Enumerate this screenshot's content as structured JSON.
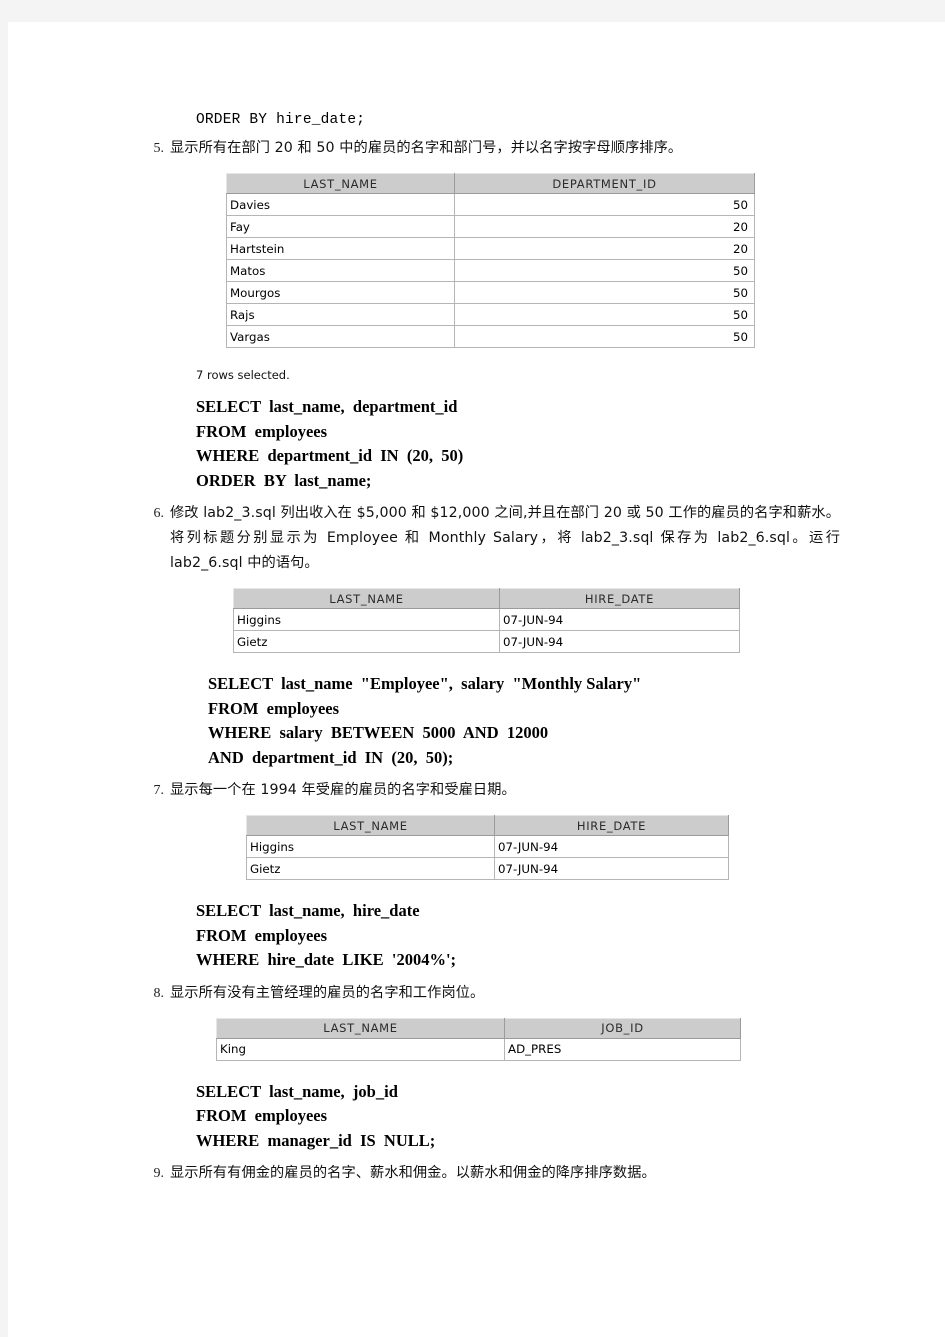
{
  "document": {
    "top_code_line": "ORDER BY hire_date;",
    "rows_selected_note": "7 rows selected."
  },
  "items": [
    {
      "number": "5.",
      "text": "显示所有在部门 20 和 50 中的雇员的名字和部门号，并以名字按字母顺序排序。"
    },
    {
      "number": "6.",
      "text": "修改 lab2_3.sql 列出收入在 $5,000 和 $12,000 之间,并且在部门 20 或 50 工作的雇员的名字和薪水。将列标题分别显示为 Employee 和 Monthly Salary，将 lab2_3.sql 保存为 lab2_6.sql。运行 lab2_6.sql 中的语句。"
    },
    {
      "number": "7.",
      "text": "显示每一个在 1994 年受雇的雇员的名字和受雇日期。"
    },
    {
      "number": "8.",
      "text": "显示所有没有主管经理的雇员的名字和工作岗位。"
    },
    {
      "number": "9.",
      "text": "显示所有有佣金的雇员的名字、薪水和佣金。以薪水和佣金的降序排序数据。"
    }
  ],
  "tables": {
    "t5": {
      "headers": [
        "LAST_NAME",
        "DEPARTMENT_ID"
      ],
      "rows": [
        [
          "Davies",
          "50"
        ],
        [
          "Fay",
          "20"
        ],
        [
          "Hartstein",
          "20"
        ],
        [
          "Matos",
          "50"
        ],
        [
          "Mourgos",
          "50"
        ],
        [
          "Rajs",
          "50"
        ],
        [
          "Vargas",
          "50"
        ]
      ]
    },
    "t6": {
      "headers": [
        "LAST_NAME",
        "HIRE_DATE"
      ],
      "rows": [
        [
          "Higgins",
          "07-JUN-94"
        ],
        [
          "Gietz",
          "07-JUN-94"
        ]
      ]
    },
    "t7": {
      "headers": [
        "LAST_NAME",
        "HIRE_DATE"
      ],
      "rows": [
        [
          "Higgins",
          "07-JUN-94"
        ],
        [
          "Gietz",
          "07-JUN-94"
        ]
      ]
    },
    "t8": {
      "headers": [
        "LAST_NAME",
        "JOB_ID"
      ],
      "rows": [
        [
          "King",
          "AD_PRES"
        ]
      ]
    }
  },
  "sql": {
    "q5": [
      "SELECT  last_name,  department_id",
      "FROM  employees",
      "WHERE  department_id  IN  (20,  50)",
      "ORDER  BY  last_name;"
    ],
    "q6": [
      "SELECT  last_name  \"Employee\",  salary  \"Monthly Salary\"",
      "FROM  employees",
      "WHERE  salary  BETWEEN  5000  AND  12000",
      "AND  department_id  IN  (20,  50);"
    ],
    "q7": [
      "SELECT  last_name,  hire_date",
      "FROM  employees",
      "WHERE  hire_date  LIKE  '2004%';"
    ],
    "q8": [
      "SELECT  last_name,  job_id",
      "FROM  employees",
      "WHERE  manager_id  IS  NULL;"
    ]
  }
}
